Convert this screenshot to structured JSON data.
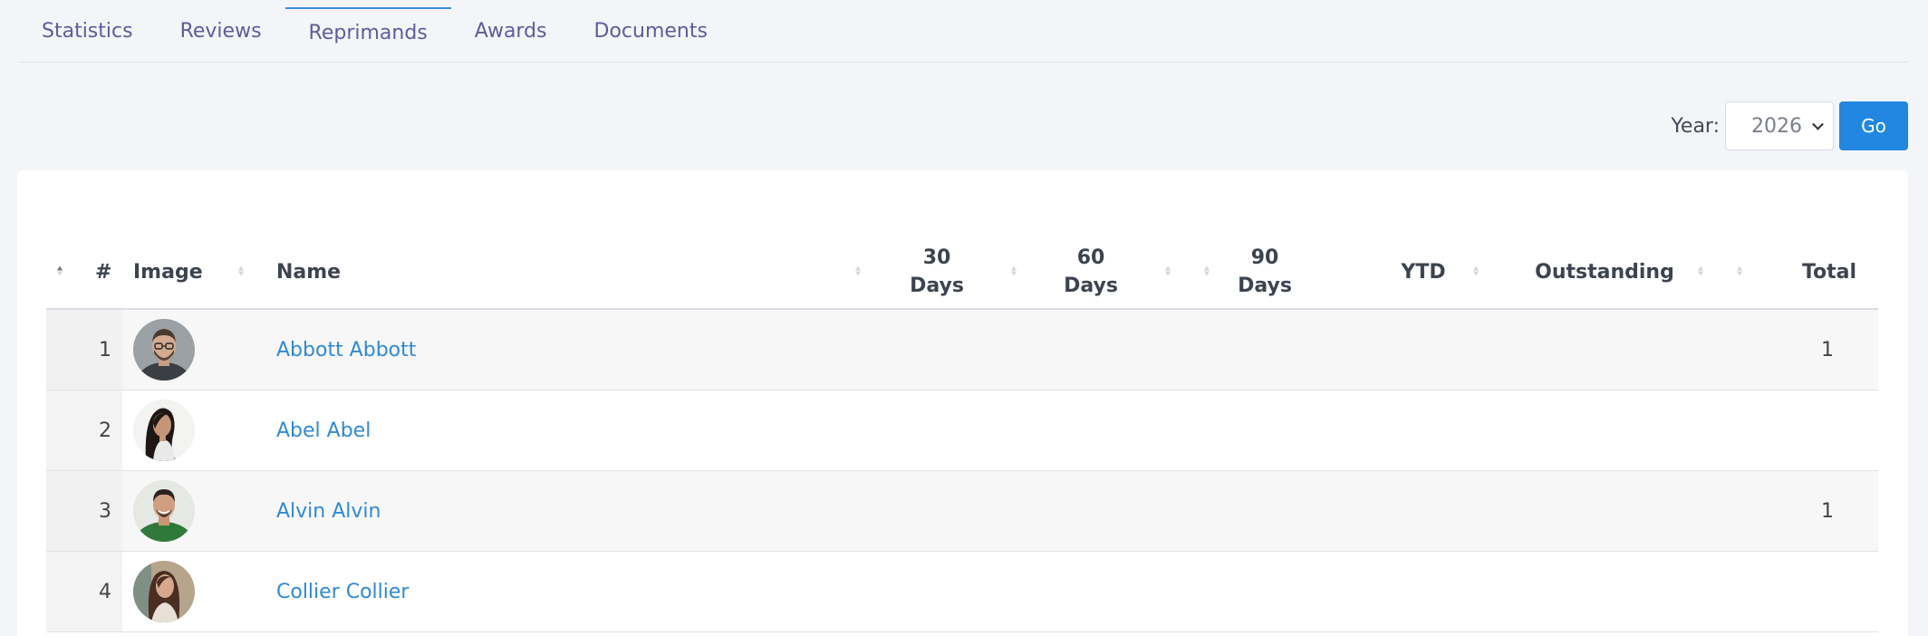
{
  "tabs": [
    {
      "label": "Statistics",
      "active": false
    },
    {
      "label": "Reviews",
      "active": false
    },
    {
      "label": "Reprimands",
      "active": true
    },
    {
      "label": "Awards",
      "active": false
    },
    {
      "label": "Documents",
      "active": false
    }
  ],
  "filter": {
    "label": "Year:",
    "selected_year": "2026",
    "go_label": "Go"
  },
  "table": {
    "columns": {
      "number": "#",
      "image": "Image",
      "name": "Name",
      "d30_line1": "30",
      "d30_line2": "Days",
      "d60_line1": "60",
      "d60_line2": "Days",
      "d90_line1": "90",
      "d90_line2": "Days",
      "ytd": "YTD",
      "outstanding": "Outstanding",
      "total": "Total"
    },
    "rows": [
      {
        "num": "1",
        "name": "Abbott Abbott",
        "d30": "",
        "d60": "",
        "d90": "",
        "ytd": "",
        "outstanding": "",
        "total": "1",
        "avatar": "man-glasses-beard"
      },
      {
        "num": "2",
        "name": "Abel Abel",
        "d30": "",
        "d60": "",
        "d90": "",
        "ytd": "",
        "outstanding": "",
        "total": "",
        "avatar": "woman-dark-hair"
      },
      {
        "num": "3",
        "name": "Alvin Alvin",
        "d30": "",
        "d60": "",
        "d90": "",
        "ytd": "",
        "outstanding": "",
        "total": "1",
        "avatar": "man-green-shirt"
      },
      {
        "num": "4",
        "name": "Collier Collier",
        "d30": "",
        "d60": "",
        "d90": "",
        "ytd": "",
        "outstanding": "",
        "total": "",
        "avatar": "woman-long-hair"
      }
    ]
  },
  "colors": {
    "accent": "#2187e0",
    "link": "#2f8ad6",
    "tab_text": "#5f5b9e"
  }
}
